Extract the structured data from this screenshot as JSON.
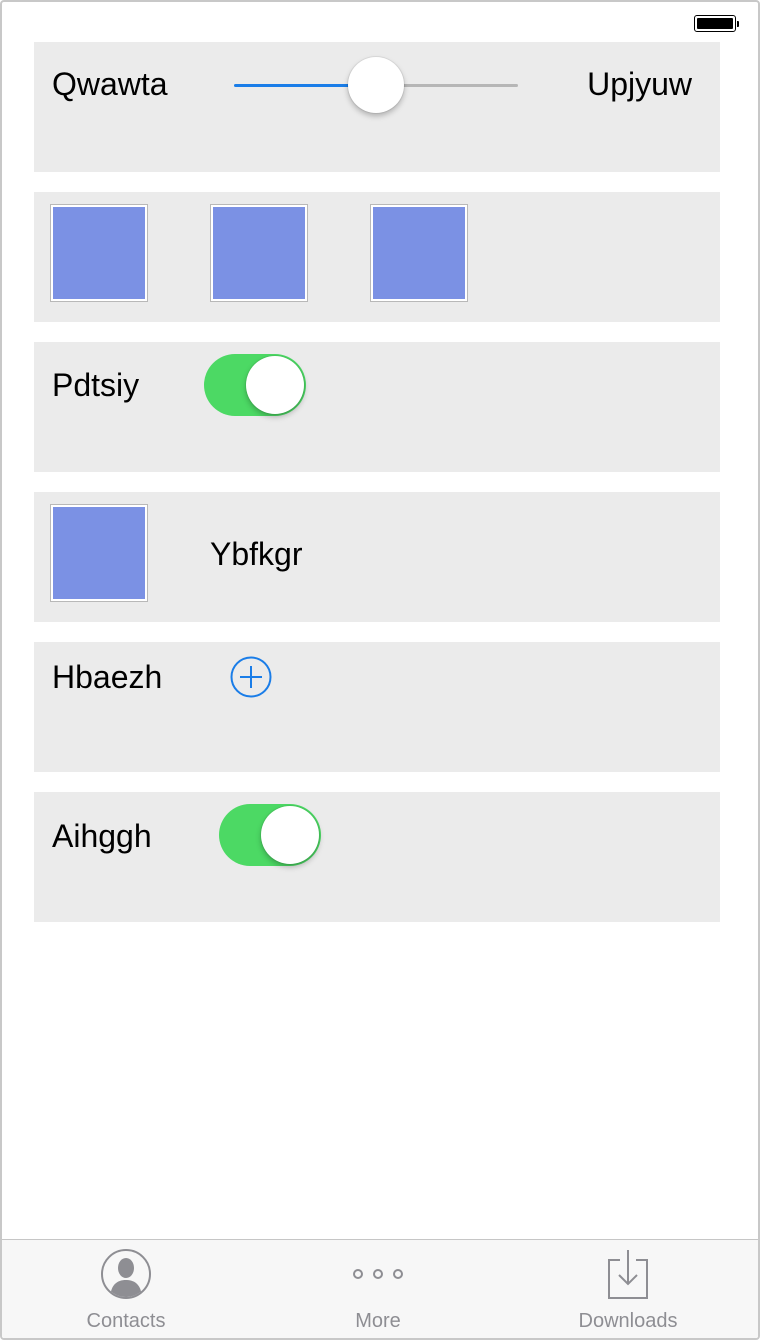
{
  "colors": {
    "accent": "#1a7de8",
    "toggle_on": "#4cd964",
    "row_bg": "#ebebeb",
    "thumb": "#7b91e4",
    "tab_inactive": "#8e8e93"
  },
  "rows": {
    "slider": {
      "min_label": "Qwawta",
      "max_label": "Upjyuw",
      "value_fraction": 0.5
    },
    "images": {
      "count": 3
    },
    "toggle1": {
      "label": "Pdtsiy",
      "on": true
    },
    "image_label": {
      "label": "Ybfkgr"
    },
    "add": {
      "label": "Hbaezh",
      "icon": "plus-circle-icon"
    },
    "toggle2": {
      "label": "Aihggh",
      "on": true
    }
  },
  "tabbar": {
    "tabs": [
      {
        "label": "Contacts",
        "icon": "contact-icon"
      },
      {
        "label": "More",
        "icon": "more-icon"
      },
      {
        "label": "Downloads",
        "icon": "download-icon"
      }
    ]
  }
}
